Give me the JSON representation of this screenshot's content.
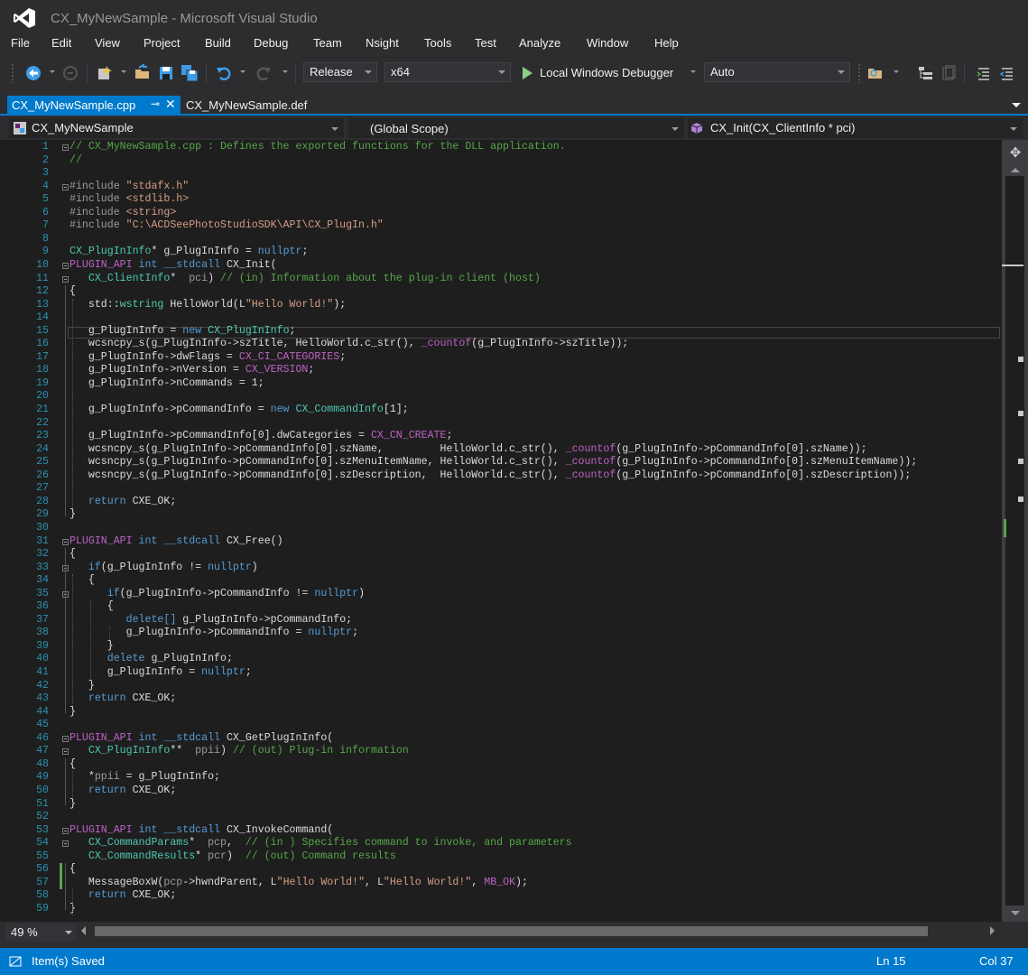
{
  "window": {
    "title": "CX_MyNewSample - Microsoft Visual Studio"
  },
  "menu": [
    "File",
    "Edit",
    "View",
    "Project",
    "Build",
    "Debug",
    "Team",
    "Nsight",
    "Tools",
    "Test",
    "Analyze",
    "Window",
    "Help"
  ],
  "toolbar": {
    "configuration": "Release",
    "platform": "x64",
    "debugger": "Local Windows Debugger",
    "debugger_mode": "Auto"
  },
  "tabs": {
    "active": "CX_MyNewSample.cpp",
    "inactive": "CX_MyNewSample.def"
  },
  "navbar": {
    "project": "CX_MyNewSample",
    "scope": "(Global Scope)",
    "member": "CX_Init(CX_ClientInfo * pci)"
  },
  "editor": {
    "line_numbers": [
      "1",
      "2",
      "3",
      "4",
      "5",
      "6",
      "7",
      "8",
      "9",
      "10",
      "11",
      "12",
      "13",
      "14",
      "15",
      "16",
      "17",
      "18",
      "19",
      "20",
      "21",
      "22",
      "23",
      "24",
      "25",
      "26",
      "27",
      "28",
      "29",
      "30",
      "31",
      "32",
      "33",
      "34",
      "35",
      "36",
      "37",
      "38",
      "39",
      "40",
      "41",
      "42",
      "43",
      "44",
      "45",
      "46",
      "47",
      "48",
      "49",
      "50",
      "51",
      "52",
      "53",
      "54",
      "55",
      "56",
      "57",
      "58",
      "59"
    ],
    "lines": [
      [
        [
          "c-com",
          "// CX_MyNewSample.cpp : Defines the exported functions for the DLL application."
        ]
      ],
      [
        [
          "c-com",
          "//"
        ]
      ],
      [],
      [
        [
          "c-pp",
          "#include "
        ],
        [
          "c-str",
          "\"stdafx.h\""
        ]
      ],
      [
        [
          "c-pp",
          "#include "
        ],
        [
          "c-str",
          "<stdlib.h>"
        ]
      ],
      [
        [
          "c-pp",
          "#include "
        ],
        [
          "c-str",
          "<string>"
        ]
      ],
      [
        [
          "c-pp",
          "#include "
        ],
        [
          "c-str",
          "\"C:\\ACDSeePhotoStudioSDK\\API\\CX_PlugIn.h\""
        ]
      ],
      [],
      [
        [
          "c-typ",
          "CX_PlugInInfo"
        ],
        [
          "",
          "* g_PlugInInfo = "
        ],
        [
          "c-kw",
          "nullptr"
        ],
        [
          "",
          ";"
        ]
      ],
      [
        [
          "c-mac",
          "PLUGIN_API"
        ],
        [
          "",
          " "
        ],
        [
          "c-kw",
          "int"
        ],
        [
          "",
          " "
        ],
        [
          "c-kw",
          "__stdcall"
        ],
        [
          "",
          " CX_Init("
        ]
      ],
      [
        [
          "",
          "   "
        ],
        [
          "c-typ",
          "CX_ClientInfo"
        ],
        [
          "",
          "*  "
        ],
        [
          "c-par",
          "pci"
        ],
        [
          "",
          ") "
        ],
        [
          "c-com",
          "// (in) Information about the plug-in client (host)"
        ]
      ],
      [
        [
          "",
          "{"
        ]
      ],
      [
        [
          "",
          "   std::"
        ],
        [
          "c-typ",
          "wstring"
        ],
        [
          "",
          " HelloWorld(L"
        ],
        [
          "c-str",
          "\"Hello World!\""
        ],
        [
          "",
          ");"
        ]
      ],
      [],
      [
        [
          "",
          "   g_PlugInInfo = "
        ],
        [
          "c-kw",
          "new"
        ],
        [
          "",
          " "
        ],
        [
          "c-typ",
          "CX_PlugInInfo"
        ],
        [
          "",
          ";"
        ]
      ],
      [
        [
          "",
          "   wcsncpy_s(g_PlugInInfo->szTitle, HelloWorld.c_str(), "
        ],
        [
          "c-mac",
          "_countof"
        ],
        [
          "",
          "(g_PlugInInfo->szTitle));"
        ]
      ],
      [
        [
          "",
          "   g_PlugInInfo->dwFlags = "
        ],
        [
          "c-mac",
          "CX_CI_CATEGORIES"
        ],
        [
          "",
          ";"
        ]
      ],
      [
        [
          "",
          "   g_PlugInInfo->nVersion = "
        ],
        [
          "c-mac",
          "CX_VERSION"
        ],
        [
          "",
          ";"
        ]
      ],
      [
        [
          "",
          "   g_PlugInInfo->nCommands = 1;"
        ]
      ],
      [],
      [
        [
          "",
          "   g_PlugInInfo->pCommandInfo = "
        ],
        [
          "c-kw",
          "new"
        ],
        [
          "",
          " "
        ],
        [
          "c-typ",
          "CX_CommandInfo"
        ],
        [
          "",
          "[1];"
        ]
      ],
      [],
      [
        [
          "",
          "   g_PlugInInfo->pCommandInfo[0].dwCategories = "
        ],
        [
          "c-mac",
          "CX_CN_CREATE"
        ],
        [
          "",
          ";"
        ]
      ],
      [
        [
          "",
          "   wcsncpy_s(g_PlugInInfo->pCommandInfo[0].szName,         HelloWorld.c_str(), "
        ],
        [
          "c-mac",
          "_countof"
        ],
        [
          "",
          "(g_PlugInInfo->pCommandInfo[0].szName));"
        ]
      ],
      [
        [
          "",
          "   wcsncpy_s(g_PlugInInfo->pCommandInfo[0].szMenuItemName, HelloWorld.c_str(), "
        ],
        [
          "c-mac",
          "_countof"
        ],
        [
          "",
          "(g_PlugInInfo->pCommandInfo[0].szMenuItemName));"
        ]
      ],
      [
        [
          "",
          "   wcsncpy_s(g_PlugInInfo->pCommandInfo[0].szDescription,  HelloWorld.c_str(), "
        ],
        [
          "c-mac",
          "_countof"
        ],
        [
          "",
          "(g_PlugInInfo->pCommandInfo[0].szDescription));"
        ]
      ],
      [],
      [
        [
          "",
          "   "
        ],
        [
          "c-kw",
          "return"
        ],
        [
          "",
          " CXE_OK;"
        ]
      ],
      [
        [
          "",
          "}"
        ]
      ],
      [],
      [
        [
          "c-mac",
          "PLUGIN_API"
        ],
        [
          "",
          " "
        ],
        [
          "c-kw",
          "int"
        ],
        [
          "",
          " "
        ],
        [
          "c-kw",
          "__stdcall"
        ],
        [
          "",
          " CX_Free()"
        ]
      ],
      [
        [
          "",
          "{"
        ]
      ],
      [
        [
          "",
          "   "
        ],
        [
          "c-kw",
          "if"
        ],
        [
          "",
          "(g_PlugInInfo != "
        ],
        [
          "c-kw",
          "nullptr"
        ],
        [
          "",
          ")"
        ]
      ],
      [
        [
          "",
          "   {"
        ]
      ],
      [
        [
          "",
          "      "
        ],
        [
          "c-kw",
          "if"
        ],
        [
          "",
          "(g_PlugInInfo->pCommandInfo != "
        ],
        [
          "c-kw",
          "nullptr"
        ],
        [
          "",
          ")"
        ]
      ],
      [
        [
          "",
          "      {"
        ]
      ],
      [
        [
          "",
          "         "
        ],
        [
          "c-kw",
          "delete[]"
        ],
        [
          "",
          " g_PlugInInfo->pCommandInfo;"
        ]
      ],
      [
        [
          "",
          "         g_PlugInInfo->pCommandInfo = "
        ],
        [
          "c-kw",
          "nullptr"
        ],
        [
          "",
          ";"
        ]
      ],
      [
        [
          "",
          "      }"
        ]
      ],
      [
        [
          "",
          "      "
        ],
        [
          "c-kw",
          "delete"
        ],
        [
          "",
          " g_PlugInInfo;"
        ]
      ],
      [
        [
          "",
          "      g_PlugInInfo = "
        ],
        [
          "c-kw",
          "nullptr"
        ],
        [
          "",
          ";"
        ]
      ],
      [
        [
          "",
          "   }"
        ]
      ],
      [
        [
          "",
          "   "
        ],
        [
          "c-kw",
          "return"
        ],
        [
          "",
          " CXE_OK;"
        ]
      ],
      [
        [
          "",
          "}"
        ]
      ],
      [],
      [
        [
          "c-mac",
          "PLUGIN_API"
        ],
        [
          "",
          " "
        ],
        [
          "c-kw",
          "int"
        ],
        [
          "",
          " "
        ],
        [
          "c-kw",
          "__stdcall"
        ],
        [
          "",
          " CX_GetPlugInInfo("
        ]
      ],
      [
        [
          "",
          "   "
        ],
        [
          "c-typ",
          "CX_PlugInInfo"
        ],
        [
          "",
          "**  "
        ],
        [
          "c-par",
          "ppii"
        ],
        [
          "",
          ") "
        ],
        [
          "c-com",
          "// (out) Plug-in information"
        ]
      ],
      [
        [
          "",
          "{"
        ]
      ],
      [
        [
          "",
          "   *"
        ],
        [
          "c-par",
          "ppii"
        ],
        [
          "",
          " = g_PlugInInfo;"
        ]
      ],
      [
        [
          "",
          "   "
        ],
        [
          "c-kw",
          "return"
        ],
        [
          "",
          " CXE_OK;"
        ]
      ],
      [
        [
          "",
          "}"
        ]
      ],
      [],
      [
        [
          "c-mac",
          "PLUGIN_API"
        ],
        [
          "",
          " "
        ],
        [
          "c-kw",
          "int"
        ],
        [
          "",
          " "
        ],
        [
          "c-kw",
          "__stdcall"
        ],
        [
          "",
          " CX_InvokeCommand("
        ]
      ],
      [
        [
          "",
          "   "
        ],
        [
          "c-typ",
          "CX_CommandParams"
        ],
        [
          "",
          "*  "
        ],
        [
          "c-par",
          "pcp"
        ],
        [
          "",
          ",  "
        ],
        [
          "c-com",
          "// (in ) Specifies command to invoke, and parameters"
        ]
      ],
      [
        [
          "",
          "   "
        ],
        [
          "c-typ",
          "CX_CommandResults"
        ],
        [
          "",
          "* "
        ],
        [
          "c-par",
          "pcr"
        ],
        [
          "",
          ")  "
        ],
        [
          "c-com",
          "// (out) Command results"
        ]
      ],
      [
        [
          "",
          "{"
        ]
      ],
      [
        [
          "",
          "   MessageBoxW("
        ],
        [
          "c-par",
          "pcp"
        ],
        [
          "",
          "->hwndParent, L"
        ],
        [
          "c-str",
          "\"Hello World!\""
        ],
        [
          "",
          ", L"
        ],
        [
          "c-str",
          "\"Hello World!\""
        ],
        [
          "",
          ", "
        ],
        [
          "c-mac",
          "MB_OK"
        ],
        [
          "",
          ");"
        ]
      ],
      [
        [
          "",
          "   "
        ],
        [
          "c-kw",
          "return"
        ],
        [
          "",
          " CXE_OK;"
        ]
      ],
      [
        [
          "",
          "}"
        ]
      ]
    ]
  },
  "zoom": "49 %",
  "status": {
    "message": "Item(s) Saved",
    "line": "Ln 15",
    "column": "Col 37"
  },
  "colors": {
    "accent": "#007acc",
    "editor_bg": "#1e1e1e",
    "chrome_bg": "#2d2d30",
    "keyword": "#569cd6",
    "comment": "#57a64a",
    "string": "#d69d85",
    "macro": "#bd63c5",
    "type": "#4ec9b0",
    "line_number": "#2b91af"
  }
}
